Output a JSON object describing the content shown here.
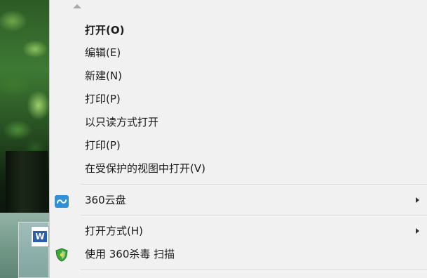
{
  "menu": {
    "items": [
      {
        "label": "打开(O)",
        "bold": true
      },
      {
        "label": "编辑(E)"
      },
      {
        "label": "新建(N)"
      },
      {
        "label": "打印(P)"
      },
      {
        "label": "以只读方式打开"
      },
      {
        "label": "打印(P)"
      },
      {
        "label": "在受保护的视图中打开(V)"
      },
      {
        "label": "360云盘",
        "icon": "cloud-360-icon",
        "submenu": true
      },
      {
        "label": "打开方式(H)",
        "submenu": true
      },
      {
        "label": "使用 360杀毒 扫描",
        "icon": "shield-360-icon"
      }
    ]
  },
  "desktop": {
    "file_icon_letter": "W"
  },
  "colors": {
    "menu_bg": "#f1f1f1",
    "cloud_icon": "#2f8fd8",
    "shield_icon": "#3aa83a",
    "word_blue": "#2a5fab"
  }
}
